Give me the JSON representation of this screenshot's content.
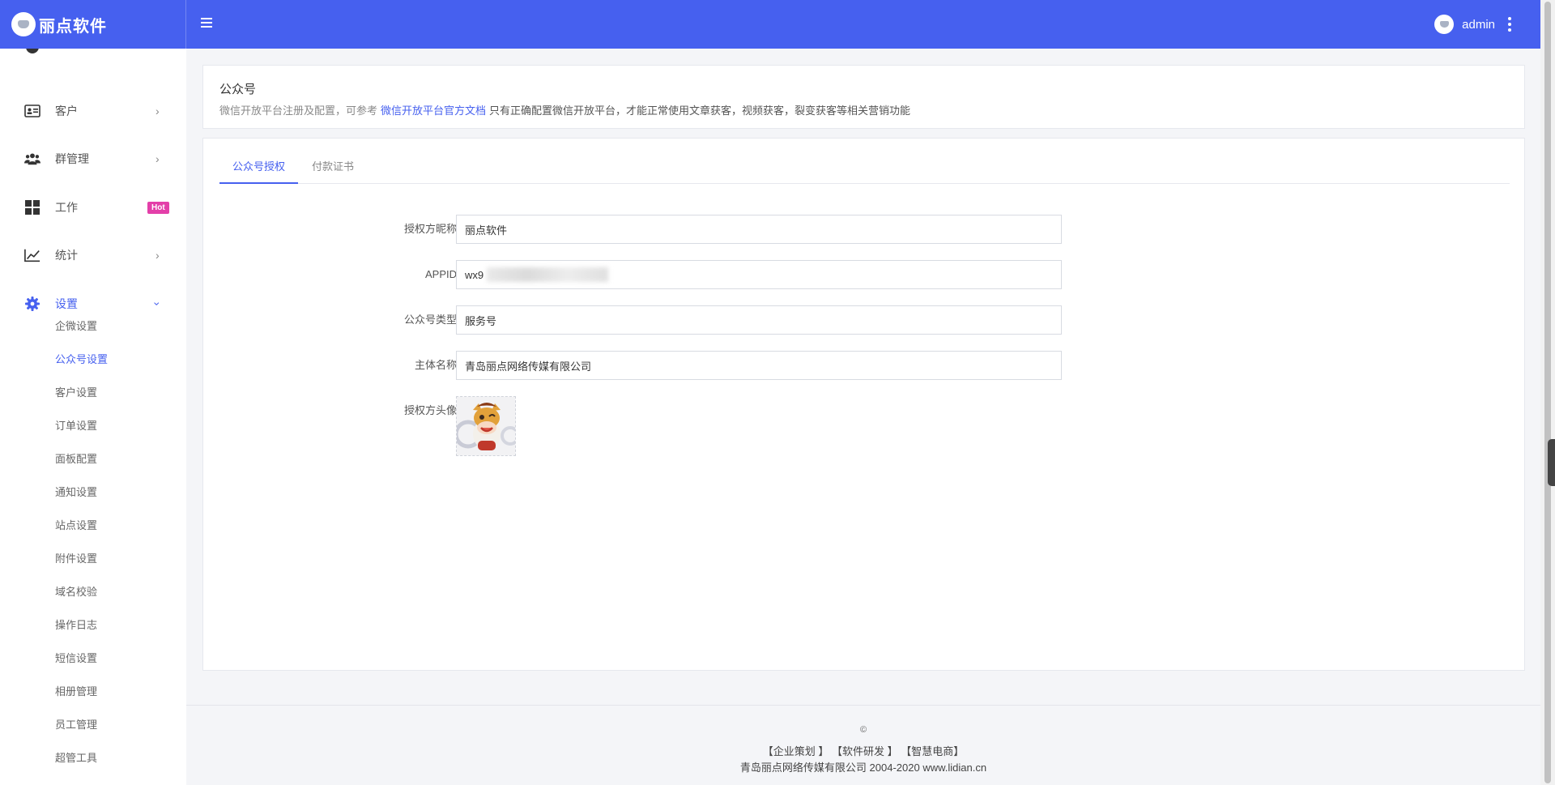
{
  "brand": {
    "name": "丽点软件"
  },
  "user": {
    "name": "admin"
  },
  "sidebar": {
    "items": [
      {
        "label": "客户",
        "arrow": "›"
      },
      {
        "label": "群管理",
        "arrow": "›"
      },
      {
        "label": "工作",
        "badge": "Hot"
      },
      {
        "label": "统计",
        "arrow": "›"
      },
      {
        "label": "设置",
        "arrow": "›"
      }
    ],
    "sub_items": [
      "企微设置",
      "公众号设置",
      "客户设置",
      "订单设置",
      "面板配置",
      "通知设置",
      "站点设置",
      "附件设置",
      "域名校验",
      "操作日志",
      "短信设置",
      "相册管理",
      "员工管理",
      "超管工具"
    ]
  },
  "header": {
    "title": "公众号",
    "desc_prefix": "微信开放平台注册及配置，可参考",
    "desc_link": "微信开放平台官方文档",
    "desc_suffix": "只有正确配置微信开放平台，才能正常使用文章获客，视频获客，裂变获客等相关营销功能"
  },
  "tabs": [
    "公众号授权",
    "付款证书"
  ],
  "form": {
    "nickname_label": "授权方昵称",
    "nickname_value": "丽点软件",
    "appid_label": "APPID",
    "appid_value": "wx9",
    "type_label": "公众号类型",
    "type_value": "服务号",
    "entity_label": "主体名称",
    "entity_value": "青岛丽点网络传媒有限公司",
    "avatar_label": "授权方头像"
  },
  "footer": {
    "copyright": "©",
    "links": [
      "【企业策划 】",
      "【软件研发 】",
      "【智慧电商】"
    ],
    "company": "青岛丽点网络传媒有限公司 2004-2020 www.lidian.cn"
  },
  "colors": {
    "primary": "#4660ef",
    "hot_badge": "#e33fa9"
  }
}
